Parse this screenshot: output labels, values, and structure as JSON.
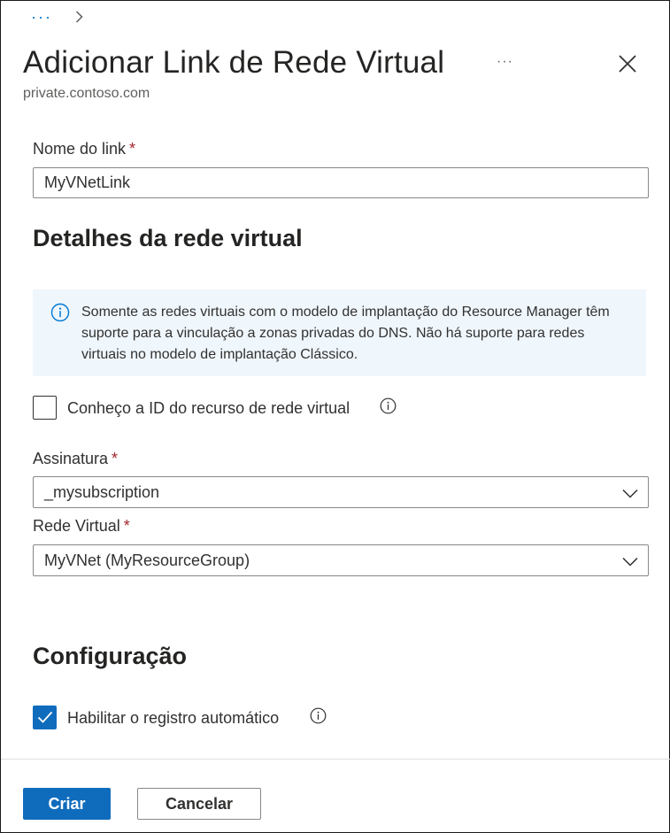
{
  "breadcrumb": {
    "more_label": "···",
    "chevron_icon": "chevron-right-icon"
  },
  "header": {
    "title": "Adicionar Link de Rede Virtual",
    "subtitle": "private.contoso.com",
    "more_label": "···",
    "close_icon": "close-icon"
  },
  "link_name": {
    "label": "Nome do link",
    "required_mark": "*",
    "value": "MyVNetLink"
  },
  "vnet_details": {
    "heading": "Detalhes da rede virtual",
    "info_icon": "info-icon",
    "info_text": "Somente as redes virtuais com o modelo de implantação do Resource Manager têm suporte para a vinculação a zonas privadas do DNS. Não há suporte para redes virtuais no modelo de implantação Clássico.",
    "know_resource_id": {
      "label": "Conheço a ID do recurso de rede virtual",
      "checked": false
    }
  },
  "subscription": {
    "label": "Assinatura",
    "required_mark": "*",
    "value": "_mysubscription"
  },
  "virtual_network": {
    "label": "Rede Virtual",
    "required_mark": "*",
    "value": "MyVNet (MyResourceGroup)"
  },
  "configuration": {
    "heading": "Configuração",
    "auto_registration": {
      "label": "Habilitar o registro automático",
      "checked": true
    }
  },
  "footer": {
    "create_label": "Criar",
    "cancel_label": "Cancelar"
  },
  "colors": {
    "accent": "#0f6cbd",
    "link": "#0078d4",
    "required": "#a4262c",
    "info_background": "#eff6fc"
  }
}
